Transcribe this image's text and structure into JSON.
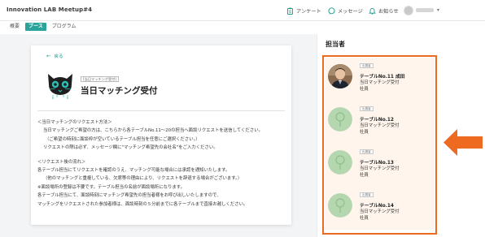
{
  "header": {
    "app_title": "Innovation LAB Meetup#4",
    "questionnaire": "アンケート",
    "messages": "メッセージ",
    "notifications": "お知らせ"
  },
  "tabs": [
    {
      "label": "概要",
      "active": false
    },
    {
      "label": "ブース",
      "active": true
    },
    {
      "label": "プログラム",
      "active": false
    }
  ],
  "booth": {
    "back_label": "戻る",
    "tag": "[当日マッチング受付]",
    "title": "当日マッチング受付",
    "body_lines": [
      "＜当日マッチングのリクエスト方法＞",
      "当日マッチングご希望の方は、こちらから各テーブルNo.11〜20の担当へ面談リクエストを送信してください。",
      "（ご希望の時刻に面談枠が空いているテーブル担当を任意にご選択ください。）",
      "リクエストの際は必ず、メッセージ欄に\"マッチング希望先の会社名\"をご入力ください。",
      "＜リクエスト後の流れ＞",
      "各テーブル担当にてリクエストを確認のうえ、マッチング可能な場合には承認を通知いたします。",
      "（他のマッチングと重複している、欠席等の理由により、リクエストを辞退する場合がございます。）",
      "※面談場所の登録は不要です。テーブル担当の名前が面談場所になります。",
      "各テーブル担当にて、面談時刻にマッチング希望先の担当者様をお呼び出しいたしますので、",
      "マッチングをリクエストされた参加者様は、面談時刻の５分前までに各テーブルまで直接お越しください。"
    ]
  },
  "panel": {
    "title": "担当者",
    "people": [
      {
        "role": "出展者",
        "name": "テーブルNo.11 成田",
        "company": "当日マッチング受付",
        "position": "社員",
        "has_photo": true
      },
      {
        "role": "出展者",
        "name": "テーブルNo.12",
        "company": "当日マッチング受付",
        "position": "社員",
        "has_photo": false
      },
      {
        "role": "出展者",
        "name": "テーブルNo.13",
        "company": "当日マッチング受付",
        "position": "社員",
        "has_photo": false
      },
      {
        "role": "出展者",
        "name": "テーブルNo.14",
        "company": "当日マッチング受付",
        "position": "社員",
        "has_photo": false
      }
    ]
  },
  "colors": {
    "accent": "#2aa39a",
    "highlight": "#ee6a21",
    "panel_fill": "#fff5ec"
  }
}
